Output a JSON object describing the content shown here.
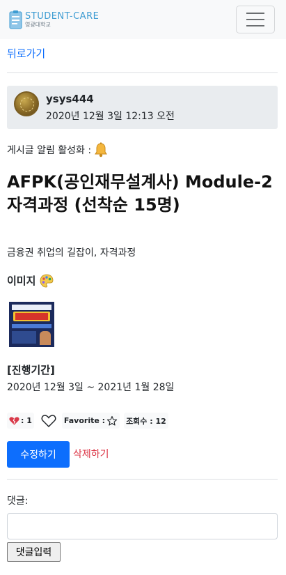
{
  "navbar": {
    "brand_en": "STUDENT-CARE",
    "brand_kr": "영광대학교",
    "menu_icon": "hamburger-menu-icon"
  },
  "back_link": "뒤로가기",
  "post": {
    "author": "ysys444",
    "date": "2020년 12월 3일 12:13 오전",
    "alert_label": "게시글 알림 활성화 :",
    "alert_icon": "bell-icon",
    "title": "AFPK(공인재무설계사) Module-2 자격과정 (선착순 15명)",
    "subtitle": "금융권 취업의 길잡이, 자격과정",
    "image_label": "이미지",
    "image_icon": "palette-icon",
    "period_label": "[진행기간]",
    "period_value": "2020년 12월 3일 ~ 2021년 1월 28일"
  },
  "stats": {
    "likes_label": ": 1",
    "favorite_label": "Favorite :",
    "views_label": "조회수 : 12"
  },
  "actions": {
    "edit_label": "수정하기",
    "delete_label": "삭제하기"
  },
  "comments": {
    "label": "댓글:",
    "input_value": "",
    "submit_label": "댓글입력"
  },
  "colors": {
    "primary": "#0d6efd",
    "danger": "#dc3545",
    "brand": "#3d9cd2"
  }
}
